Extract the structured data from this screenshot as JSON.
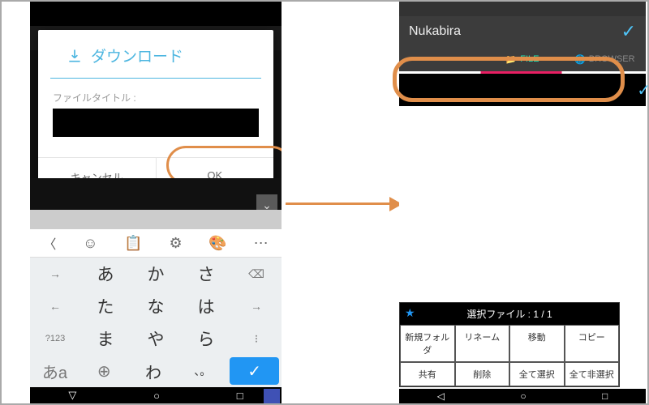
{
  "left": {
    "dialog": {
      "title": "ダウンロード",
      "file_label": "ファイルタイトル :",
      "cancel": "キャンセル",
      "ok": "OK"
    },
    "keyboard": {
      "toolbar_chev": "〈",
      "row1": [
        "→",
        "あ",
        "か",
        "さ",
        "⌫"
      ],
      "row2": [
        "←",
        "た",
        "な",
        "は",
        "→"
      ],
      "row3": [
        "?123",
        "ま",
        "や",
        "ら",
        "⁝"
      ],
      "row4_mode": "あa",
      "row4": [
        "⊕",
        "わ",
        "、。",
        "✓"
      ]
    }
  },
  "right": {
    "app_title": "Nukabira",
    "tabs": {
      "file": "FILE",
      "browser": "BROWSER"
    },
    "menu": {
      "header": "選択ファイル : 1 / 1",
      "cells": [
        "新規フォルダ",
        "リネーム",
        "移動",
        "コピー",
        "共有",
        "削除",
        "全て選択",
        "全て非選択"
      ]
    }
  }
}
